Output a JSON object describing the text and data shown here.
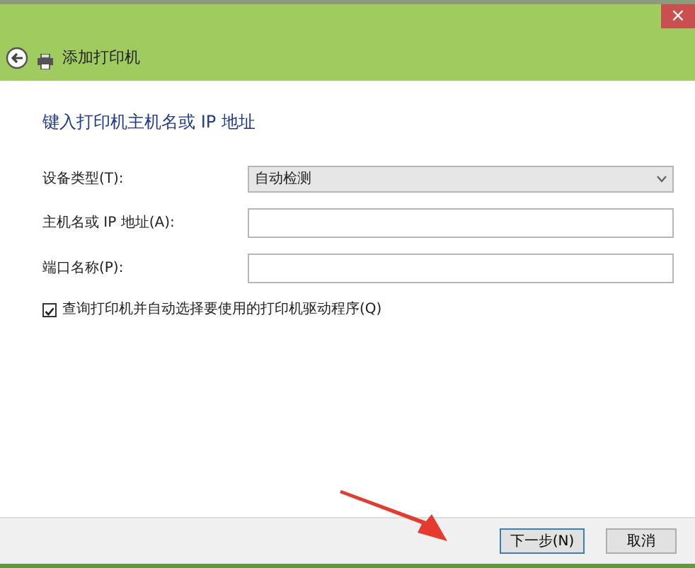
{
  "window": {
    "title": "添加打印机",
    "close_label": "×"
  },
  "heading": "键入打印机主机名或 IP 地址",
  "fields": [
    {
      "kind": "select",
      "label": "设备类型(T):",
      "value": "自动检测"
    },
    {
      "kind": "input",
      "label": "主机名或 IP 地址(A):"
    },
    {
      "kind": "input",
      "label": "端口名称(P):"
    }
  ],
  "query_option": {
    "label": "查询打印机并自动选择要使用的打印机驱动程序(Q)",
    "checked": true
  },
  "buttons": [
    {
      "label": "下一步(N)",
      "selected": true
    },
    {
      "label": "取消",
      "selected": false
    }
  ]
}
